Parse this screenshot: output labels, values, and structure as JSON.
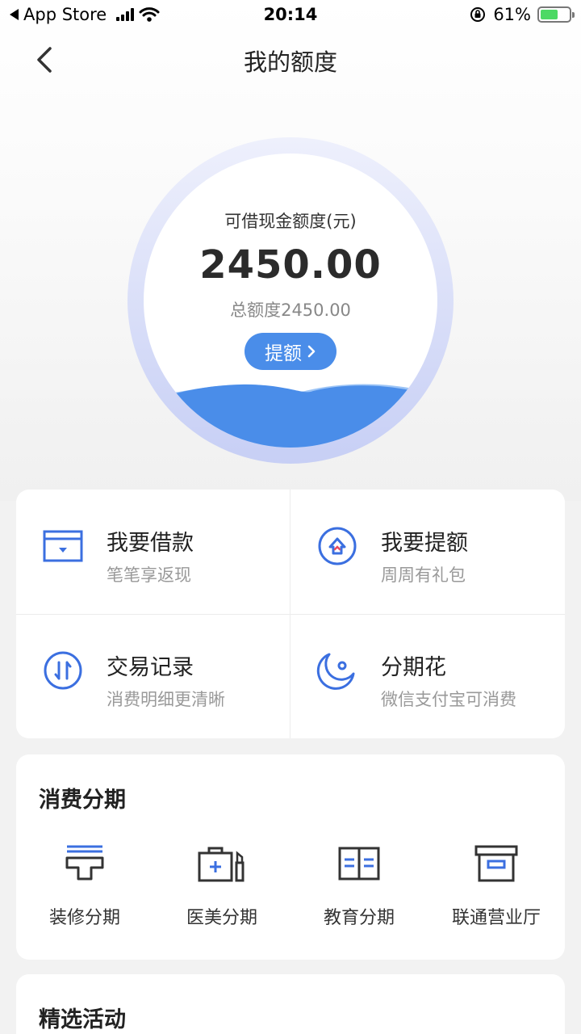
{
  "status_bar": {
    "back_app": "App Store",
    "time": "20:14",
    "battery": "61%",
    "battery_level": 0.61
  },
  "nav": {
    "title": "我的额度"
  },
  "credit": {
    "label": "可借现金额度(元)",
    "amount": "2450.00",
    "total": "总额度2450.00",
    "raise_button": "提额"
  },
  "grid": [
    {
      "title": "我要借款",
      "subtitle": "笔笔享返现",
      "icon": "wallet-icon"
    },
    {
      "title": "我要提额",
      "subtitle": "周周有礼包",
      "icon": "limit-up-icon"
    },
    {
      "title": "交易记录",
      "subtitle": "消费明细更清晰",
      "icon": "transaction-icon"
    },
    {
      "title": "分期花",
      "subtitle": "微信支付宝可消费",
      "icon": "moon-icon"
    }
  ],
  "installments": {
    "title": "消费分期",
    "items": [
      {
        "label": "装修分期",
        "icon": "renovation-icon"
      },
      {
        "label": "医美分期",
        "icon": "medical-beauty-icon"
      },
      {
        "label": "教育分期",
        "icon": "education-icon"
      },
      {
        "label": "联通营业厅",
        "icon": "store-box-icon"
      }
    ]
  },
  "activity": {
    "title": "精选活动"
  },
  "colors": {
    "accent": "#4a8de9",
    "icon_blue": "#3b6fe0",
    "ring": "#c7cff5"
  }
}
